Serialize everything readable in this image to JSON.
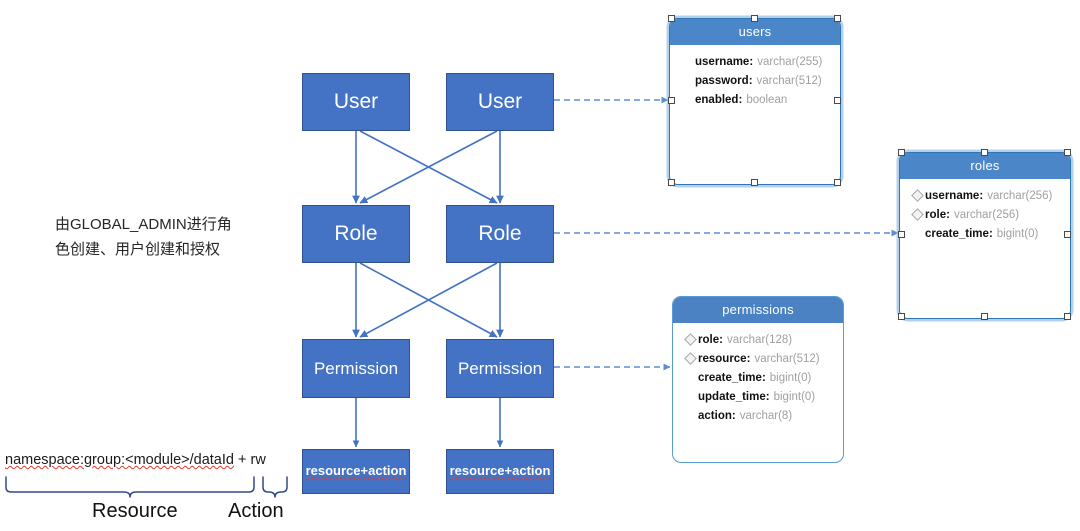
{
  "diagram": {
    "title": "RBAC permission model diagram",
    "note": "由GLOBAL_ADMIN进行角\n色创建、用户创建和授权"
  },
  "colors": {
    "box_fill": "#4472C4",
    "box_border": "#2F528F",
    "connector": "#4472C4",
    "table_border": "#5B9BD5",
    "table_header": "#4A82C3",
    "type_text": "#A0A0A0",
    "spellcheck": "#E03C31"
  },
  "flow": {
    "left_column": [
      {
        "label": "User",
        "size": "big"
      },
      {
        "label": "Role",
        "size": "big"
      },
      {
        "label": "Permission",
        "size": "mid"
      },
      {
        "label": "resource+action",
        "size": "small",
        "spellcheck": true
      }
    ],
    "right_column": [
      {
        "label": "User",
        "size": "big"
      },
      {
        "label": "Role",
        "size": "big"
      },
      {
        "label": "Permission",
        "size": "mid"
      },
      {
        "label": "resource+action",
        "size": "small",
        "spellcheck": true
      }
    ]
  },
  "legend": {
    "expression_parts": [
      {
        "text": "namespace:group:<module>/dataId",
        "spellcheck": true
      },
      {
        "text": " + ",
        "spellcheck": false
      },
      {
        "text": "rw",
        "spellcheck": false
      }
    ],
    "expression_full": "namespace:group:<module>/dataId + rw",
    "brace_left_label": "Resource",
    "brace_right_label": "Action"
  },
  "tables": [
    {
      "name": "users",
      "selected": true,
      "fields": [
        {
          "name": "username",
          "type": "varchar(255)",
          "key": false
        },
        {
          "name": "password",
          "type": "varchar(512)",
          "key": false
        },
        {
          "name": "enabled",
          "type": "boolean",
          "key": false
        }
      ]
    },
    {
      "name": "roles",
      "selected": true,
      "fields": [
        {
          "name": "username",
          "type": "varchar(256)",
          "key": true
        },
        {
          "name": "role",
          "type": "varchar(256)",
          "key": true
        },
        {
          "name": "create_time",
          "type": "bigint(0)",
          "key": false
        }
      ]
    },
    {
      "name": "permissions",
      "selected": false,
      "fields": [
        {
          "name": "role",
          "type": "varchar(128)",
          "key": true
        },
        {
          "name": "resource",
          "type": "varchar(512)",
          "key": true
        },
        {
          "name": "create_time",
          "type": "bigint(0)",
          "key": false
        },
        {
          "name": "update_time",
          "type": "bigint(0)",
          "key": false
        },
        {
          "name": "action",
          "type": "varchar(8)",
          "key": false
        }
      ]
    }
  ]
}
